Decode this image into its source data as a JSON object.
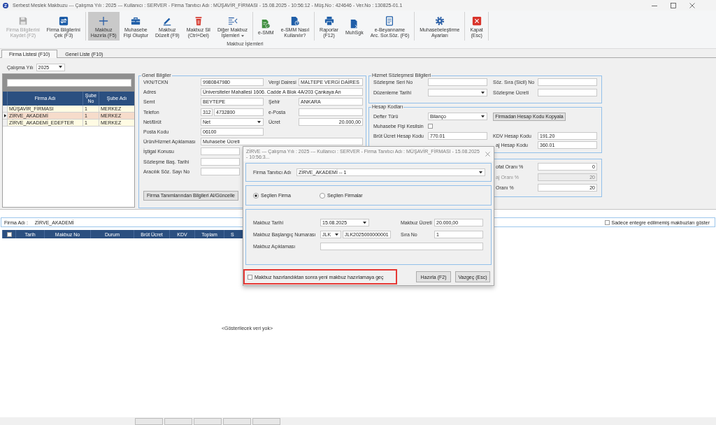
{
  "window": {
    "title": "Serbest Meslek Makbuzu --- Çalışma Yılı : 2025 --- Kullanıcı : SERVER - Firma Tanıtıcı Adı : MÜŞAVİR_FİRMASI - 15.08.2025 - 10:56:12 - Müş.No : 424646 - Ver.No : 130825-01.1"
  },
  "ribbon": {
    "sections": [
      {
        "buttons": [
          {
            "lines": [
              "Firma Bilgilerini",
              "Kaydet (F2)"
            ],
            "disabled": true,
            "selected": false,
            "menu": false
          },
          {
            "lines": [
              "Firma Bilgilerini",
              "Çek (F3)"
            ],
            "disabled": false,
            "selected": false,
            "menu": false
          }
        ]
      },
      {
        "buttons": [
          {
            "lines": [
              "Makbuz",
              "Hazırla (F5)"
            ],
            "disabled": false,
            "selected": true,
            "menu": false
          },
          {
            "lines": [
              "Muhasebe",
              "Fişi Oluştur"
            ],
            "disabled": false,
            "selected": false,
            "menu": false
          },
          {
            "lines": [
              "Makbuz",
              "Düzelt (F9)"
            ],
            "disabled": false,
            "selected": false,
            "menu": false
          },
          {
            "lines": [
              "Makbuz Sil",
              "(Ctrl+Del)"
            ],
            "disabled": false,
            "selected": false,
            "menu": false
          },
          {
            "lines": [
              "Diğer Makbuz",
              "İşlemleri"
            ],
            "disabled": false,
            "selected": false,
            "menu": true
          }
        ]
      },
      {
        "buttons": [
          {
            "lines": [
              "e-SMM"
            ],
            "disabled": false,
            "selected": false,
            "menu": false
          },
          {
            "lines": [
              "e-SMM Nasıl",
              "Kullanılır?"
            ],
            "disabled": false,
            "selected": false,
            "menu": false
          }
        ]
      },
      {
        "buttons": [
          {
            "lines": [
              "Raporlar",
              "(F12)"
            ],
            "disabled": false,
            "selected": false,
            "menu": false
          },
          {
            "lines": [
              "MuhSgk"
            ],
            "disabled": false,
            "selected": false,
            "menu": false
          },
          {
            "lines": [
              "e-Beyanname",
              "Arc. Sor.Söz. (F6)"
            ],
            "disabled": false,
            "selected": false,
            "menu": false
          }
        ]
      },
      {
        "buttons": [
          {
            "lines": [
              "Muhasebeleştirme",
              "Ayarları"
            ],
            "disabled": false,
            "selected": false,
            "menu": false
          }
        ]
      },
      {
        "buttons": [
          {
            "lines": [
              "Kapat",
              "(Esc)"
            ],
            "disabled": false,
            "selected": false,
            "menu": false
          }
        ]
      }
    ],
    "group_label": "Makbuz İşlemleri"
  },
  "tabs": [
    {
      "label": "Firma Listesi (F10)",
      "selected": true
    },
    {
      "label": "Genel Liste (F10)",
      "selected": false
    }
  ],
  "year_picker": {
    "label": "Çalışma Yılı",
    "value": "2025"
  },
  "firm_grid": {
    "columns": [
      "Firma Adı",
      "Şube No",
      "Şube Adı"
    ],
    "rows": [
      {
        "cells": [
          "MÜŞAVİR_FİRMASI",
          "1",
          "MERKEZ"
        ],
        "selected": false
      },
      {
        "cells": [
          "ZİRVE_AKADEMİ",
          "1",
          "MERKEZ"
        ],
        "selected": true
      },
      {
        "cells": [
          "ZİRVE_AKADEMİ_EDEFTER",
          "1",
          "MERKEZ"
        ],
        "selected": false
      }
    ]
  },
  "general_info": {
    "title": "Genel Bilgiler",
    "rows": [
      {
        "left": {
          "label": "VKN/TCKN",
          "kind": "text",
          "value": "9980847980"
        },
        "right": {
          "label": "Vergi Dairesi",
          "kind": "text",
          "value": "MALTEPE VERGİ DAİRES"
        }
      },
      {
        "left": {
          "label": "Adres",
          "kind": "wide",
          "value": "Üniversiteler Mahallesi 1606. Cadde A Blok 4A/203 Çankaya An"
        }
      },
      {
        "left": {
          "label": "Semt",
          "kind": "text",
          "value": "BEYTEPE"
        },
        "right": {
          "label": "Şehir",
          "kind": "text",
          "value": "ANKARA"
        }
      },
      {
        "left": {
          "label": "Telefon",
          "kind": "phone",
          "values": [
            "312",
            "4732800"
          ]
        },
        "right": {
          "label": "e-Posta",
          "kind": "text"
        }
      },
      {
        "left": {
          "label": "Net/Brüt",
          "kind": "combo",
          "value": "Net"
        },
        "right": {
          "label": "Ücret",
          "kind": "amount",
          "value": "20.000,00"
        }
      },
      {
        "left": {
          "label": "Posta Kodu",
          "kind": "text",
          "value": "06100"
        }
      },
      {
        "left": {
          "label": "Ürün/Hizmet Açıklaması",
          "kind": "wide",
          "value": "Muhasebe Ücreti"
        }
      },
      {
        "left": {
          "label": "İştigal Konusu",
          "kind": "text"
        }
      },
      {
        "left": {
          "label": "Sözleşme Baş. Tarihi",
          "kind": "text"
        }
      },
      {
        "left": {
          "label": "Aracılık Söz. Sayı No",
          "kind": "text"
        }
      }
    ],
    "button": "Firma Tanımlarından Bilgileri Al/Güncelle"
  },
  "contract": {
    "title": "Hizmet Sözleşmesi Bilgileri",
    "rows": [
      {
        "left": {
          "label": "Sözleşme Seri No",
          "kind": "text"
        },
        "right": {
          "label": "Söz. Sıra (Sicil) No",
          "kind": "text"
        }
      },
      {
        "left": {
          "label": "Düzenleme Tarihi",
          "kind": "combo"
        },
        "right": {
          "label": "Sözleşme Ücreti",
          "kind": "text"
        }
      }
    ]
  },
  "account_codes": {
    "title": "Hesap Kodları",
    "rows": [
      {
        "left": {
          "label": "Defter Türü",
          "kind": "combo",
          "value": "Bilanço"
        },
        "right": {
          "label": "Firmadan Hesap Kodu Kopyala",
          "kind": "button"
        }
      },
      {
        "left": {
          "label": "Muhasebe Fişi Kesilsin",
          "kind": "checkbox",
          "checked": false
        }
      },
      {
        "left": {
          "label": "Brüt Ücret Hesap Kodu",
          "kind": "text",
          "value": "770.01"
        },
        "right": {
          "label": "KDV Hesap Kodu",
          "kind": "text",
          "value": "191.20"
        }
      },
      {
        "right": {
          "label": "aj Hesap Kodu",
          "kind": "text",
          "value": "360.01"
        }
      }
    ]
  },
  "rates": {
    "rows": [
      {
        "right": {
          "label": "ofat Oranı %",
          "kind": "amount",
          "value": "0",
          "disabled": false
        }
      },
      {
        "right": {
          "label": "aj Oranı %",
          "kind": "amount",
          "value": "20",
          "disabled": true
        }
      },
      {
        "right": {
          "label": "Oranı %",
          "kind": "amount",
          "value": "20",
          "disabled": false
        }
      }
    ]
  },
  "receipt_list": {
    "firm_label": "Firma Adı :",
    "firm_name": "ZİRVE_AKADEMİ",
    "filter": {
      "label": "Sadece entegre edilmemiş makbuzları göster",
      "checked": false
    },
    "select_all": {
      "checked": false
    },
    "columns": [
      "Tarih",
      "Makbuz No",
      "Durum",
      "Brüt Ücret",
      "KDV",
      "Toplam",
      "S"
    ],
    "empty_text": "<Gösterilecek veri yok>"
  },
  "dialog": {
    "title": "ZİRVE --- Çalışma Yılı : 2025 --- Kullanıcı : SERVER - Firma Tanıtıcı Adı : MÜŞAVİR_FİRMASI - 15.08.2025 - 10:56:3...",
    "firm_picker": {
      "label": "Firma Tanıtıcı Adı",
      "value": "ZİRVE_AKADEMİ -- 1"
    },
    "scope_options": [
      {
        "label": "Seçilen Firma",
        "selected": true
      },
      {
        "label": "Seçilen Firmalar",
        "selected": false
      }
    ],
    "rows": [
      {
        "left": {
          "label": "Makbuz Tarihi",
          "kind": "combo",
          "value": "15.08.2025"
        },
        "right": {
          "label": "Makbuz Ücreti",
          "kind": "text",
          "value": "20.000,00"
        }
      },
      {
        "left": {
          "label": "Makbuz Başlangıç Numarası",
          "kind": "series",
          "values": [
            "JLK",
            "JLK2025000000001"
          ]
        },
        "right": {
          "label": "Sıra No",
          "kind": "text",
          "value": "1"
        }
      },
      {
        "left": {
          "label": "Makbuz Açıklaması",
          "kind": "wide"
        }
      }
    ],
    "continue_option": {
      "label": "Makbuz hazırlandıktan sonra yeni makbuz hazırlamaya geç",
      "checked": false,
      "highlighted": true
    },
    "buttons": [
      "Hazırla (F2)",
      "Vazgeç (Esc)"
    ]
  }
}
